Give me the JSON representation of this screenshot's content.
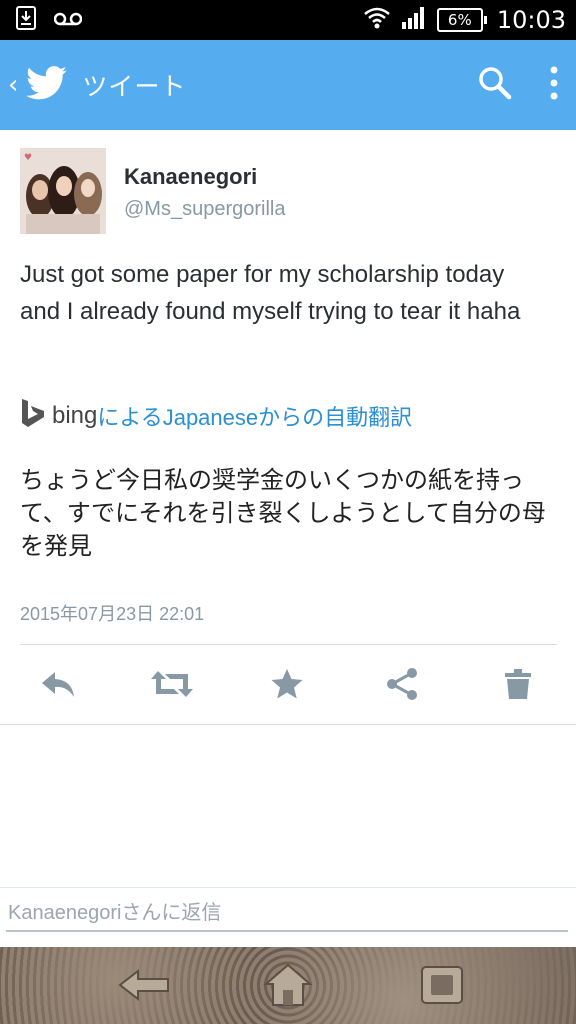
{
  "status_bar": {
    "battery": "6%",
    "time": "10:03"
  },
  "action_bar": {
    "title": "ツイート"
  },
  "tweet": {
    "display_name": "Kanaenegori",
    "screen_name": "@Ms_supergorilla",
    "text": "Just got some paper for my scholarship today and I already found myself trying to tear it haha",
    "bing_label": "bing",
    "translation_label": "によるJapaneseからの自動翻訳",
    "translated_text": "ちょうど今日私の奨学金のいくつかの紙を持って、すでにそれを引き裂くしようとして自分の母を発見",
    "timestamp": "2015年07月23日 22:01"
  },
  "reply": {
    "placeholder": "Kanaenegoriさんに返信"
  },
  "colors": {
    "twitter_blue": "#55acee",
    "link_blue": "#2b8fd6",
    "icon_gray": "#8899a6"
  }
}
